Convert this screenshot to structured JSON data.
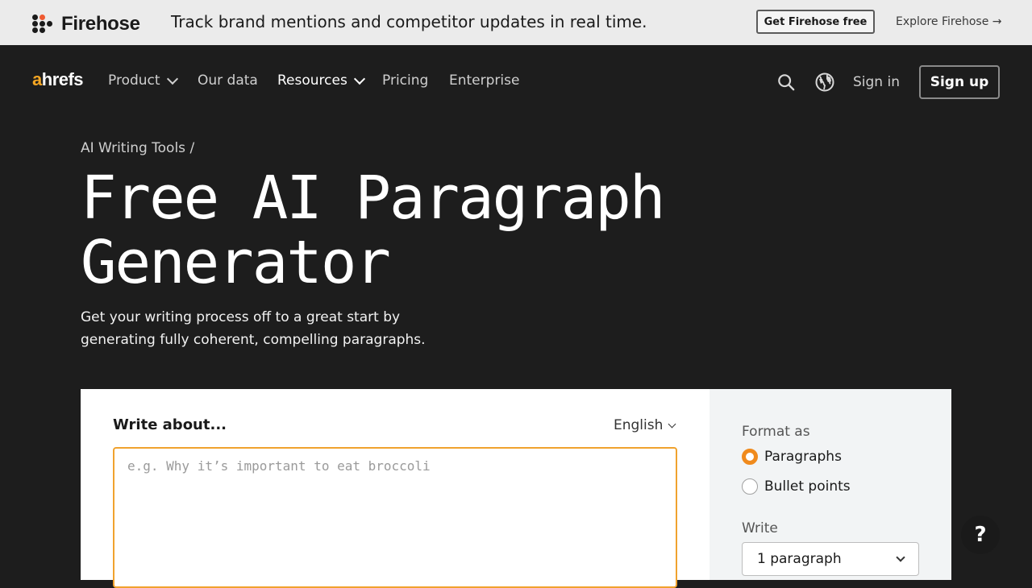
{
  "promo": {
    "brand": "Firehose",
    "text": "Track brand mentions and competitor updates in real time.",
    "cta": "Get Firehose free",
    "link": "Explore Firehose →"
  },
  "nav": {
    "logo_a": "a",
    "logo_rest": "hrefs",
    "items": [
      {
        "label": "Product"
      },
      {
        "label": "Our data"
      },
      {
        "label": "Resources"
      },
      {
        "label": "Pricing"
      },
      {
        "label": "Enterprise"
      }
    ],
    "signin": "Sign in",
    "signup": "Sign up",
    "icons": [
      "search-icon",
      "globe-icon"
    ]
  },
  "hero": {
    "breadcrumb": "AI Writing Tools /",
    "title_line1": "Free AI Paragraph",
    "title_line2": "Generator",
    "subtitle": "Get your writing process off to a great start by generating fully coherent, compelling paragraphs."
  },
  "tool": {
    "write_label": "Write about...",
    "language": "English",
    "placeholder": "e.g. Why it’s important to eat broccoli",
    "format_label": "Format as",
    "formats": [
      {
        "label": "Paragraphs",
        "selected": true
      },
      {
        "label": "Bullet points",
        "selected": false
      }
    ],
    "write_side_label": "Write",
    "count_value": "1 paragraph"
  },
  "help": "?",
  "colors": {
    "bg": "#1d1d1d",
    "accent": "#f08a1c",
    "input_border": "#f0a22e",
    "logo_accent": "#f5a623"
  }
}
